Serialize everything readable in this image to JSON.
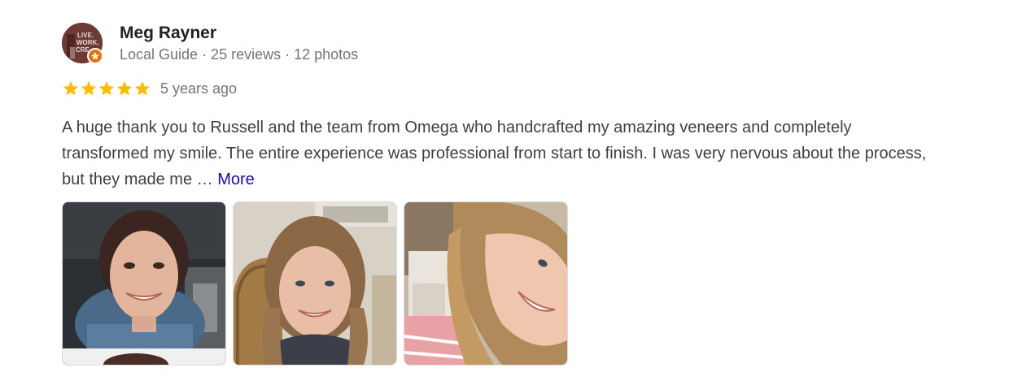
{
  "reviewer": {
    "name": "Meg Rayner",
    "meta": "Local Guide · 25 reviews · 12 photos",
    "avatar_text": [
      "LIVE.",
      "WORK.",
      "CRE"
    ]
  },
  "rating": {
    "stars": 5,
    "max": 5,
    "date": "5 years ago",
    "star_color": "#fbbc04"
  },
  "review": {
    "text": "A huge thank you to Russell and the team from Omega who handcrafted my amazing veneers and completely transformed my smile. The entire experience was professional from start to finish. I was very nervous about the process, but they made me … ",
    "more_label": "More"
  },
  "photos": [
    {
      "name": "photo-1",
      "alt": "Selfie in car"
    },
    {
      "name": "photo-2",
      "alt": "Smiling portrait"
    },
    {
      "name": "photo-3",
      "alt": "Tilted selfie"
    }
  ],
  "colors": {
    "link": "#1a0dab",
    "meta": "#70757a",
    "badge": "#e8710a"
  }
}
